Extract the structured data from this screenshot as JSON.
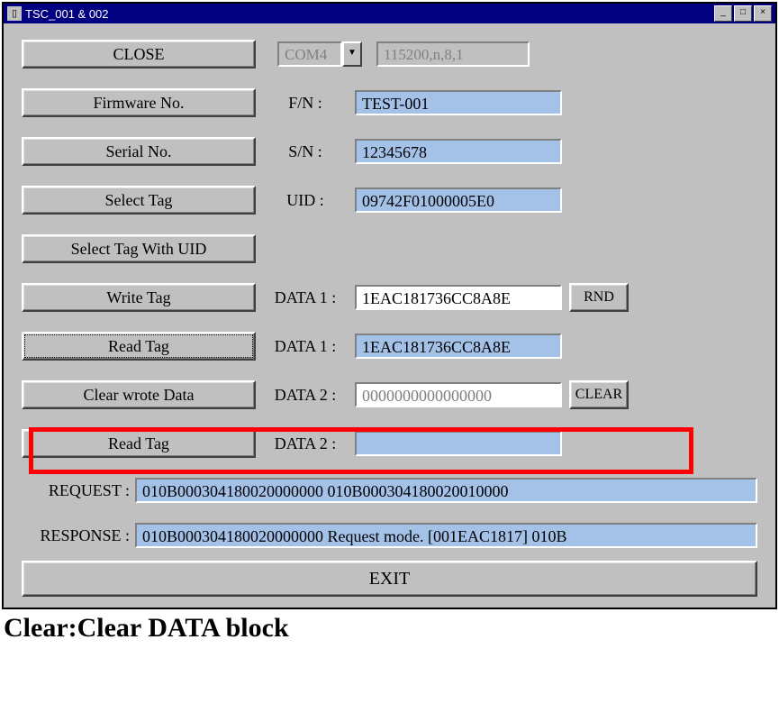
{
  "window": {
    "title": "TSC_001 & 002"
  },
  "buttons": {
    "close": "CLOSE",
    "firmware_no": "Firmware No.",
    "serial_no": "Serial No.",
    "select_tag": "Select Tag",
    "select_tag_uid": "Select Tag With UID",
    "write_tag": "Write Tag",
    "read_tag": "Read Tag",
    "clear_wrote": "Clear wrote Data",
    "read_tag2": "Read Tag",
    "rnd": "RND",
    "clear": "CLEAR",
    "exit": "EXIT"
  },
  "labels": {
    "fn": "F/N :",
    "sn": "S/N :",
    "uid": "UID :",
    "data1": "DATA 1 :",
    "data1b": "DATA 1 :",
    "data2": "DATA 2 :",
    "data2b": "DATA 2 :",
    "request": "REQUEST :",
    "response": "RESPONSE :"
  },
  "port": {
    "com": "COM4",
    "params": "115200,n,8,1"
  },
  "fields": {
    "fn": "TEST-001",
    "sn": "12345678",
    "uid": "09742F01000005E0",
    "data1_write": "1EAC181736CC8A8E",
    "data1_read": "1EAC181736CC8A8E",
    "data2_write": "0000000000000000",
    "data2_read": "",
    "request": "010B000304180020000000   010B000304180020010000",
    "response": "010B000304180020000000  Request mode.  [001EAC1817]   010B"
  },
  "caption": "Clear:Clear DATA block"
}
